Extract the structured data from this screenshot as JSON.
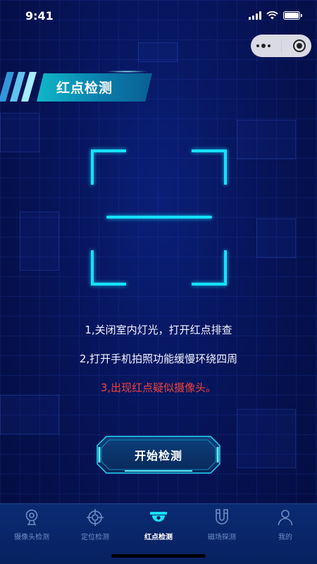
{
  "status_bar": {
    "time": "9:41"
  },
  "page": {
    "title": "红点检测"
  },
  "instructions": [
    "1,关闭室内灯光，打开红点排查",
    "2,打开手机拍照功能缓慢环绕四周",
    "3,出现红点疑似摄像头。"
  ],
  "start_button": {
    "label": "开始检测"
  },
  "tabs": [
    {
      "label": "摄像头检测",
      "icon": "camera-icon"
    },
    {
      "label": "定位检测",
      "icon": "crosshair-icon"
    },
    {
      "label": "红点检测",
      "icon": "dome-camera-icon",
      "active": true
    },
    {
      "label": "磁场探测",
      "icon": "magnet-icon"
    },
    {
      "label": "我的",
      "icon": "user-icon"
    }
  ],
  "colors": {
    "accent": "#16e1ff",
    "warning": "#f0443b",
    "background": "#05104a",
    "tab_inactive": "#6e8fc4"
  }
}
